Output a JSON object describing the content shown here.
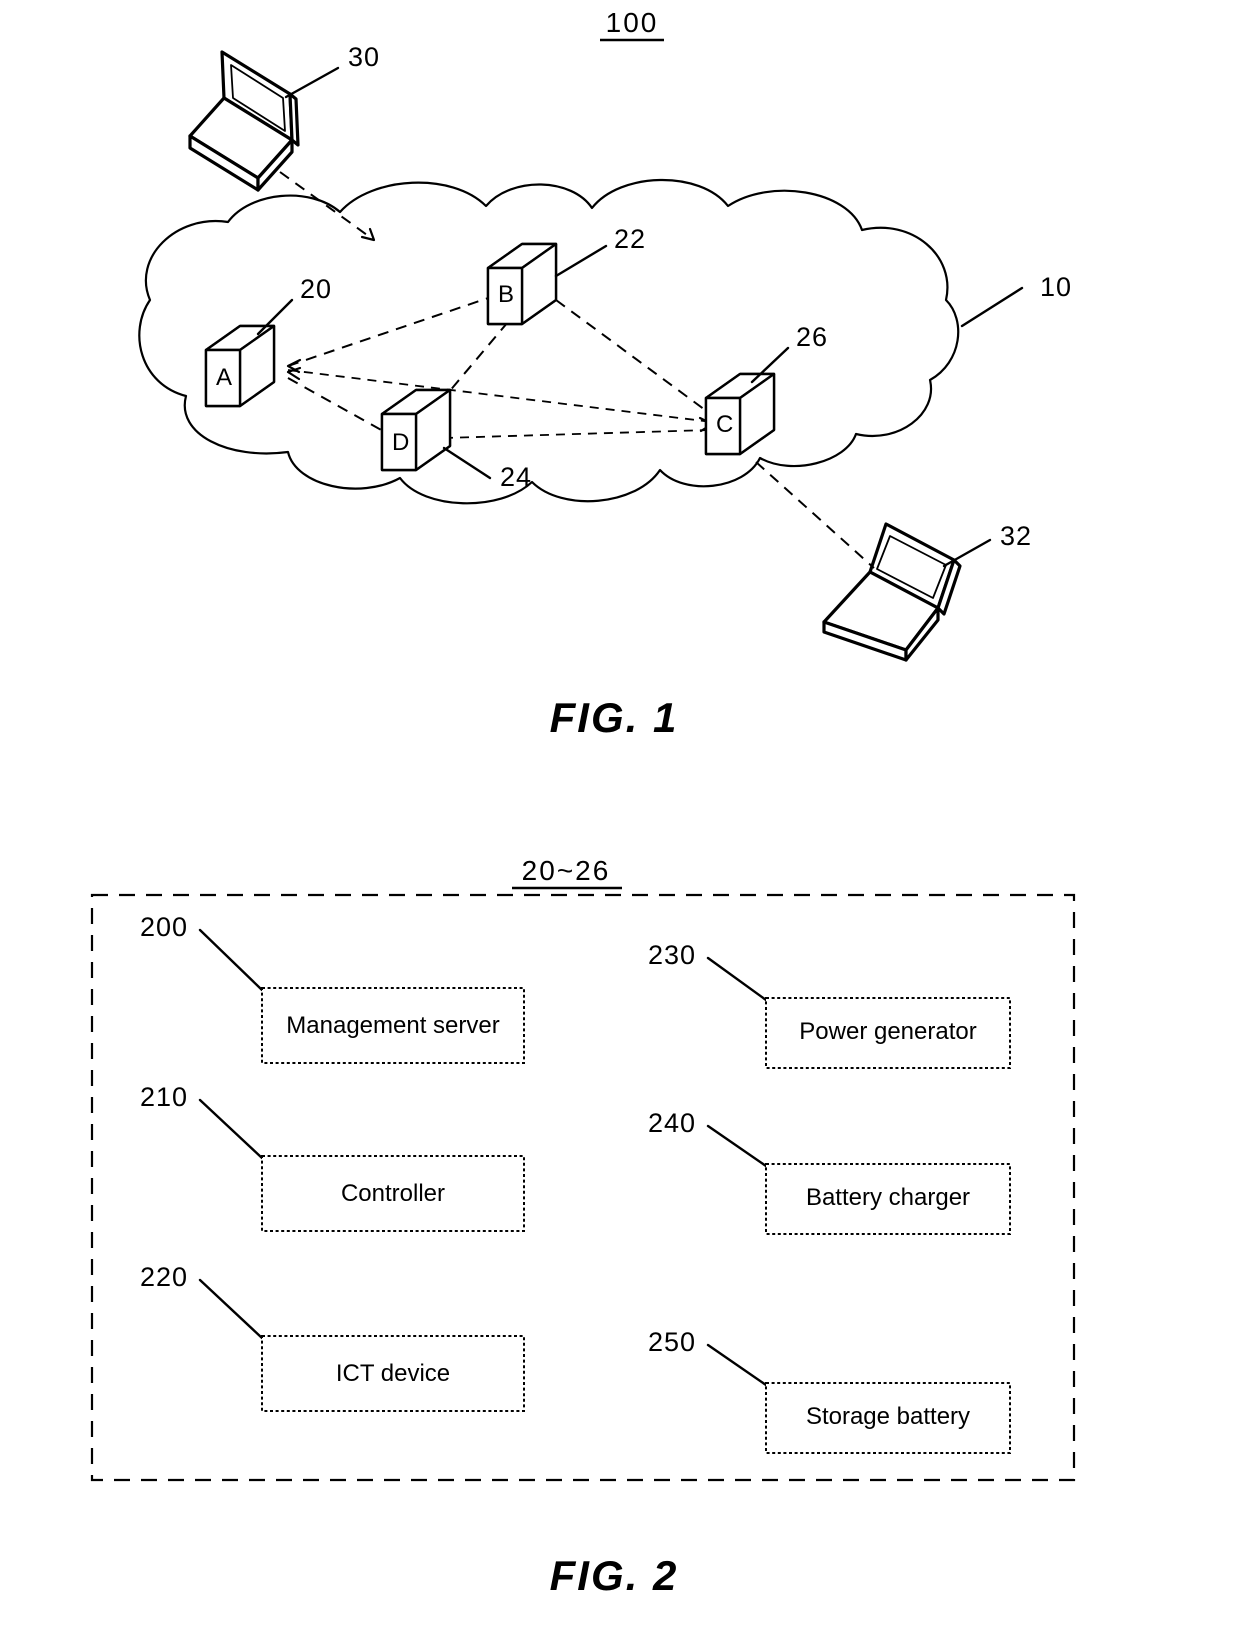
{
  "document": {
    "type": "patent-drawing-sheet",
    "figures": [
      "FIG. 1",
      "FIG. 2"
    ]
  },
  "fig1": {
    "caption": "FIG. 1",
    "title_ref": "100",
    "cloud": {
      "name": "network-cloud",
      "ref": "10"
    },
    "servers": [
      {
        "letter": "A",
        "ref": "20",
        "name": "server-a"
      },
      {
        "letter": "B",
        "ref": "22",
        "name": "server-b"
      },
      {
        "letter": "D",
        "ref": "24",
        "name": "server-d"
      },
      {
        "letter": "C",
        "ref": "26",
        "name": "server-c"
      }
    ],
    "laptops": [
      {
        "ref": "30",
        "name": "laptop-top-left"
      },
      {
        "ref": "32",
        "name": "laptop-bottom-right"
      }
    ],
    "links": [
      {
        "from": "A",
        "to": "B"
      },
      {
        "from": "A",
        "to": "C"
      },
      {
        "from": "A",
        "to": "D"
      },
      {
        "from": "B",
        "to": "C"
      },
      {
        "from": "B",
        "to": "D"
      },
      {
        "from": "D",
        "to": "C"
      },
      {
        "from": "laptop-30",
        "to": "cloud"
      },
      {
        "from": "C",
        "to": "laptop-32"
      }
    ]
  },
  "fig2": {
    "caption": "FIG. 2",
    "header_ref": "20~26",
    "components": [
      {
        "ref": "200",
        "label": "Management server",
        "name": "management-server-box"
      },
      {
        "ref": "210",
        "label": "Controller",
        "name": "controller-box"
      },
      {
        "ref": "220",
        "label": "ICT device",
        "name": "ict-device-box"
      },
      {
        "ref": "230",
        "label": "Power generator",
        "name": "power-generator-box"
      },
      {
        "ref": "240",
        "label": "Battery charger",
        "name": "battery-charger-box"
      },
      {
        "ref": "250",
        "label": "Storage battery",
        "name": "storage-battery-box"
      }
    ]
  },
  "colors": {
    "ink": "#000000",
    "paper": "#ffffff"
  }
}
